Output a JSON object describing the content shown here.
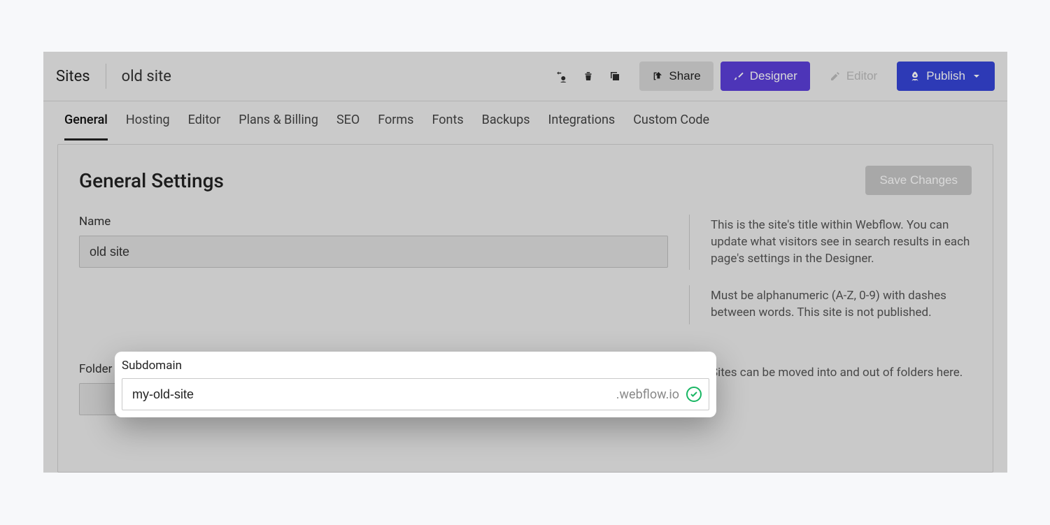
{
  "header": {
    "sites_label": "Sites",
    "site_name": "old site",
    "share_label": "Share",
    "designer_label": "Designer",
    "editor_label": "Editor",
    "publish_label": "Publish"
  },
  "tabs": [
    "General",
    "Hosting",
    "Editor",
    "Plans & Billing",
    "SEO",
    "Forms",
    "Fonts",
    "Backups",
    "Integrations",
    "Custom Code"
  ],
  "active_tab_index": 0,
  "panel": {
    "title": "General Settings",
    "save_label": "Save Changes"
  },
  "fields": {
    "name": {
      "label": "Name",
      "value": "old site",
      "help": "This is the site's title within Webflow. You can update what visitors see in search results in each page's settings in the Designer."
    },
    "subdomain": {
      "label": "Subdomain",
      "value": "my-old-site",
      "suffix": ".webflow.io",
      "help": "Must be alphanumeric (A-Z, 0-9) with dashes between words. This site is not published."
    },
    "folder": {
      "label": "Folder",
      "value": "",
      "help": "Sites can be moved into and out of folders here."
    }
  }
}
